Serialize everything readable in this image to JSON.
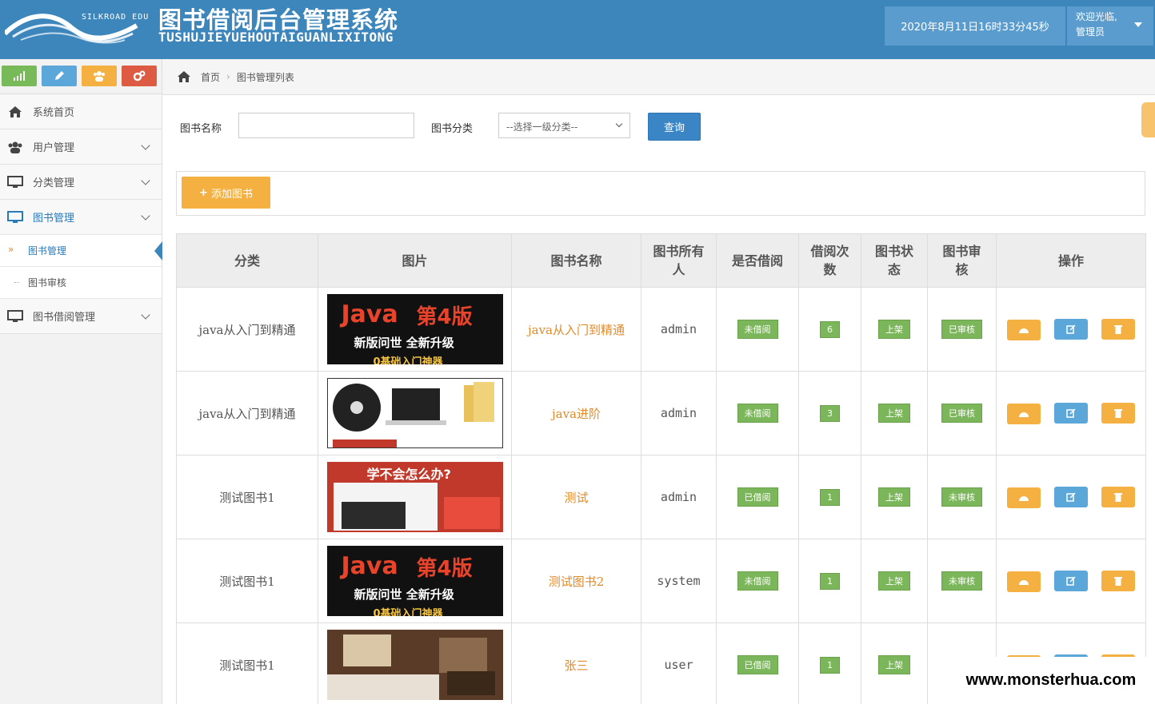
{
  "header": {
    "logo_text": "SILKROAD EDU",
    "title": "图书借阅后台管理系统",
    "pinyin": "TUSHUJIEYUEHOUTAIGUANLIXITONG",
    "datetime": "2020年8月11日16时33分45秒",
    "welcome": "欢迎光临,",
    "role": "管理员"
  },
  "colors": {
    "header_bg": "#3c86bc",
    "accent_orange": "#f5b042",
    "accent_blue": "#5ba7d9",
    "badge_green": "#7bb65a",
    "link_orange": "#e08b2b"
  },
  "shortcuts": [
    {
      "icon": "signal-icon",
      "color": "#78b95a"
    },
    {
      "icon": "pencil-icon",
      "color": "#5ba7d9"
    },
    {
      "icon": "users-icon",
      "color": "#f5b042"
    },
    {
      "icon": "cogs-icon",
      "color": "#dd5a43"
    }
  ],
  "sidebar": {
    "items": [
      {
        "label": "系统首页",
        "icon": "home-icon"
      },
      {
        "label": "用户管理",
        "icon": "users-icon"
      },
      {
        "label": "分类管理",
        "icon": "desktop-icon"
      },
      {
        "label": "图书管理",
        "icon": "desktop-icon"
      },
      {
        "label": "图书借阅管理",
        "icon": "desktop-icon"
      }
    ],
    "sub_items": [
      {
        "label": "图书管理"
      },
      {
        "label": "图书审核"
      }
    ]
  },
  "breadcrumb": {
    "home": "首页",
    "current": "图书管理列表"
  },
  "search": {
    "name_label": "图书名称",
    "name_value": "",
    "category_label": "图书分类",
    "category_selected": "--选择一级分类--",
    "query_label": "查询"
  },
  "toolbar": {
    "add_label": "添加图书"
  },
  "table": {
    "headers": [
      "分类",
      "图片",
      "图书名称",
      "图书所有人",
      "是否借阅",
      "借阅次数",
      "图书状态",
      "图书审核",
      "操作"
    ],
    "rows": [
      {
        "category": "java从入门到精通",
        "image": "Java第4版 book cover",
        "name": "java从入门到精通",
        "owner": "admin",
        "borrowed": "未借阅",
        "count": "6",
        "status": "上架",
        "review": "已审核"
      },
      {
        "category": "java从入门到精通",
        "image": "Java course materials photo",
        "name": "java进阶",
        "owner": "admin",
        "borrowed": "未借阅",
        "count": "3",
        "status": "上架",
        "review": "已审核"
      },
      {
        "category": "测试图书1",
        "image": "学不会怎么办 banner",
        "name": "测试",
        "owner": "admin",
        "borrowed": "已借阅",
        "count": "1",
        "status": "上架",
        "review": "未审核"
      },
      {
        "category": "测试图书1",
        "image": "Java第4版 book cover",
        "name": "测试图书2",
        "owner": "system",
        "borrowed": "未借阅",
        "count": "1",
        "status": "上架",
        "review": "未审核"
      },
      {
        "category": "测试图书1",
        "image": "hotel room photo",
        "name": "张三",
        "owner": "user",
        "borrowed": "已借阅",
        "count": "1",
        "status": "上架",
        "review": ""
      }
    ]
  },
  "cover_text": {
    "java": "Java",
    "edition": "第4版",
    "line2": "新版问世 全新升级",
    "line3": "0基础入门神器",
    "banner": "学不会怎么办?"
  },
  "watermark": "www.monsterhua.com"
}
